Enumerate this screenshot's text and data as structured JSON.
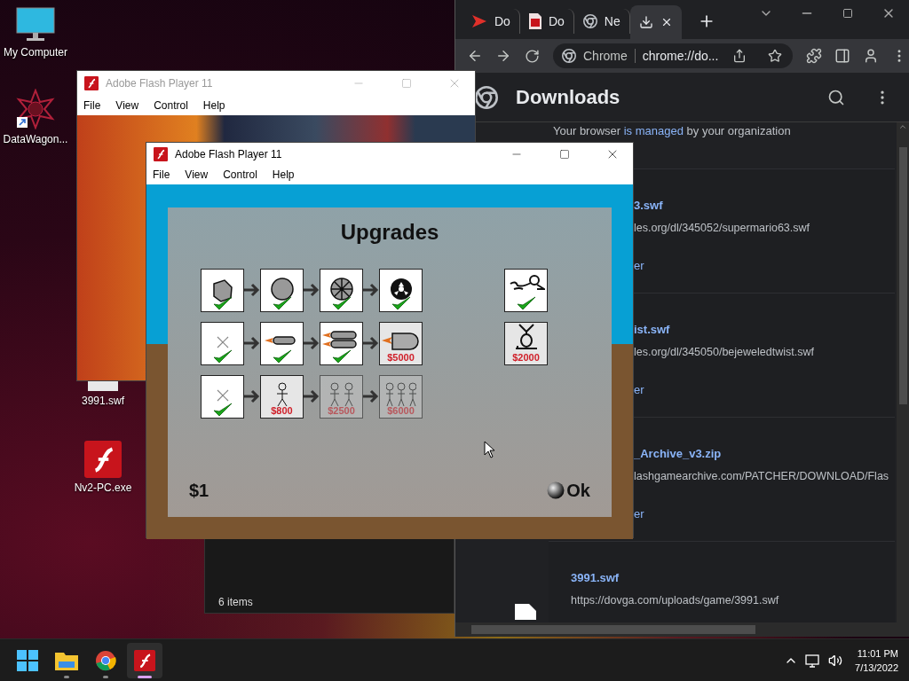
{
  "desktop_icons": [
    {
      "kind": "monitor",
      "label": "My Computer"
    },
    {
      "kind": "shortcut",
      "label": "DataWagon..."
    },
    {
      "kind": "file",
      "label": "3991.swf"
    },
    {
      "kind": "flash",
      "label": "Nv2-PC.exe"
    }
  ],
  "explorer": {
    "status": "6 items"
  },
  "browser": {
    "tabs": [
      {
        "kind": "send",
        "title": "Do",
        "selected": false
      },
      {
        "kind": "pdf",
        "title": "Do",
        "selected": false
      },
      {
        "kind": "chrome",
        "title": "Ne",
        "selected": false
      },
      {
        "kind": "download",
        "selected": true
      }
    ],
    "address": {
      "origin": "Chrome",
      "url": "chrome://do..."
    },
    "page_title": "Downloads",
    "notice": {
      "before": "Your browser ",
      "link": "is managed",
      "after": " by your organization"
    },
    "downloads": [
      {
        "name": "3.swf",
        "url": "les.org/dl/345052/supermario63.swf",
        "action": "er",
        "cut_off": true
      },
      {
        "name": "ist.swf",
        "url": "les.org/dl/345050/bejeweledtwist.swf",
        "action": "er",
        "cut_off": true
      },
      {
        "name": "_Archive_v3.zip",
        "url": "lashgamearchive.com/PATCHER/DOWNLOAD/Flas",
        "action": "er",
        "cut_off": true
      },
      {
        "name": "3991.swf",
        "url": "https://dovga.com/uploads/game/3991.swf",
        "cut_off": false
      }
    ]
  },
  "background_player": {
    "title": "Adobe Flash Player 11",
    "active": false,
    "menu": [
      "File",
      "View",
      "Control",
      "Help"
    ]
  },
  "game_player": {
    "title": "Adobe Flash Player 11",
    "active": true,
    "menu": [
      "File",
      "View",
      "Control",
      "Help"
    ],
    "game": {
      "heading": "Upgrades",
      "rows": [
        {
          "tiles": [
            {
              "kind": "rock",
              "owned": true,
              "available": true
            },
            {
              "kind": "ball",
              "owned": true,
              "available": true
            },
            {
              "kind": "wheel",
              "owned": true,
              "available": true
            },
            {
              "kind": "fan",
              "owned": true,
              "available": true
            }
          ]
        },
        {
          "tiles": [
            {
              "kind": "none",
              "owned": true,
              "available": true
            },
            {
              "kind": "rocket",
              "owned": true,
              "available": true
            },
            {
              "kind": "twin_rocket",
              "owned": true,
              "available": true
            },
            {
              "kind": "bullet",
              "owned": false,
              "available": true,
              "price": "$5000"
            }
          ]
        },
        {
          "tiles": [
            {
              "kind": "none",
              "owned": true,
              "available": true
            },
            {
              "kind": "person",
              "owned": false,
              "available": true,
              "price": "$800"
            },
            {
              "kind": "pair",
              "owned": false,
              "available": false,
              "price": "$2500"
            },
            {
              "kind": "trio",
              "owned": false,
              "available": false,
              "price": "$6000"
            }
          ]
        }
      ],
      "extras": [
        {
          "kind": "grapple",
          "owned": true,
          "available": true
        },
        {
          "kind": "pod",
          "owned": false,
          "available": true,
          "price": "$2000"
        }
      ],
      "money": "$1",
      "confirm": "Ok"
    }
  },
  "taskbar": {
    "apps": [
      {
        "kind": "start",
        "running": false,
        "active": false
      },
      {
        "kind": "explorer",
        "running": true,
        "active": false
      },
      {
        "kind": "chrome",
        "running": true,
        "active": false
      },
      {
        "kind": "flash",
        "running": true,
        "active": true
      }
    ],
    "time": "11:01 PM",
    "date": "7/13/2022"
  }
}
